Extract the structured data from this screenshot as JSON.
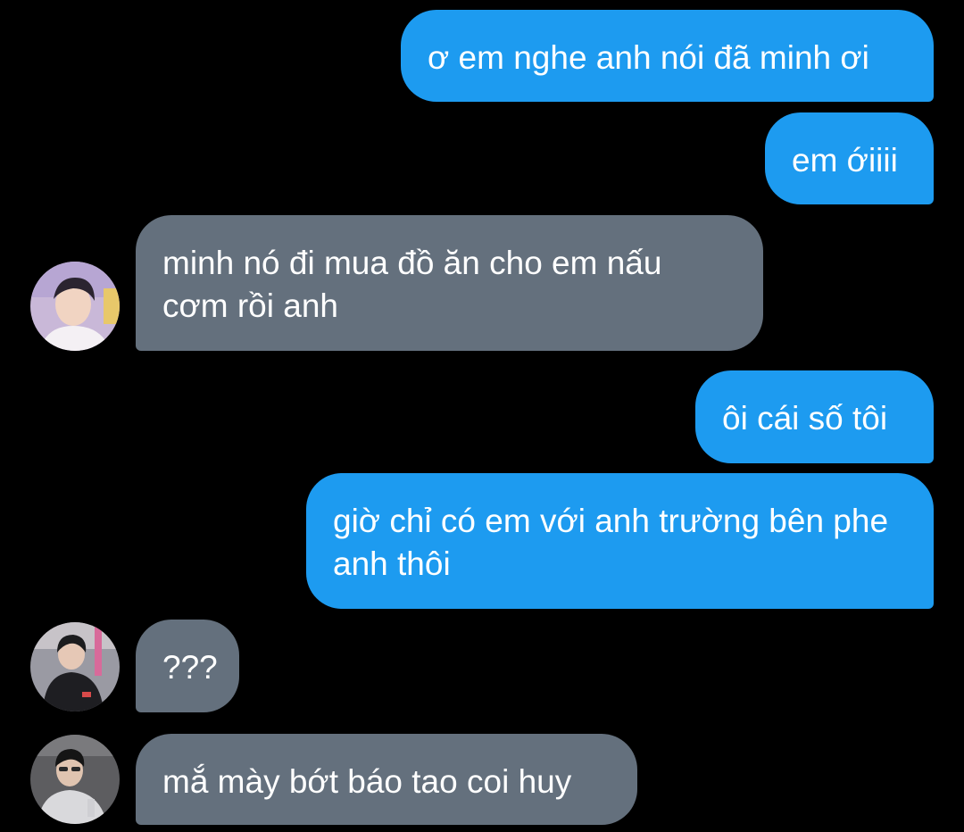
{
  "conversation": {
    "messages": [
      {
        "direction": "outgoing",
        "text": "ơ em nghe anh nói đã minh ơi"
      },
      {
        "direction": "outgoing",
        "text": "em ớiiii"
      },
      {
        "direction": "incoming",
        "text": "minh nó đi mua đồ ăn cho em nấu cơm rồi anh",
        "avatar": "avatar-photo-1"
      },
      {
        "direction": "outgoing",
        "text": "ôi cái số tôi"
      },
      {
        "direction": "outgoing",
        "text": "giờ chỉ có em với anh trường bên phe anh thôi"
      },
      {
        "direction": "incoming",
        "text": "???",
        "avatar": "avatar-photo-2"
      },
      {
        "direction": "incoming",
        "text": "mắ mày bớt báo tao coi huy",
        "avatar": "avatar-photo-3"
      }
    ]
  },
  "colors": {
    "background": "#000000",
    "outgoing_bubble": "#1d9bf0",
    "incoming_bubble": "#64707d",
    "text": "#ffffff"
  }
}
